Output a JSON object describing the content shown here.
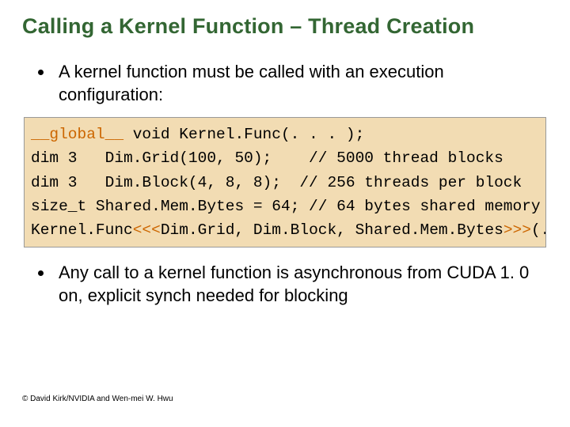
{
  "title": "Calling a Kernel Function – Thread Creation",
  "bullets": {
    "b1": "A kernel function must be called with an execution configuration:",
    "b2": "Any call to a kernel function is asynchronous from CUDA 1. 0 on, explicit synch needed for blocking"
  },
  "code": {
    "line1_kw": "__global__",
    "line1_rest": " void Kernel.Func(. . . );",
    "line2": "dim 3   Dim.Grid(100, 50);    // 5000 thread blocks",
    "line3": "dim 3   Dim.Block(4, 8, 8);  // 256 threads per block",
    "line4": "size_t Shared.Mem.Bytes = 64; // 64 bytes shared memory",
    "line5_pre": "Kernel.Func",
    "line5_open": "<<<",
    "line5_args": "Dim.Grid, Dim.Block, Shared.Mem.Bytes",
    "line5_close": ">>>",
    "line5_post": "(. . . );"
  },
  "footer": "© David Kirk/NVIDIA and Wen-mei W. Hwu"
}
